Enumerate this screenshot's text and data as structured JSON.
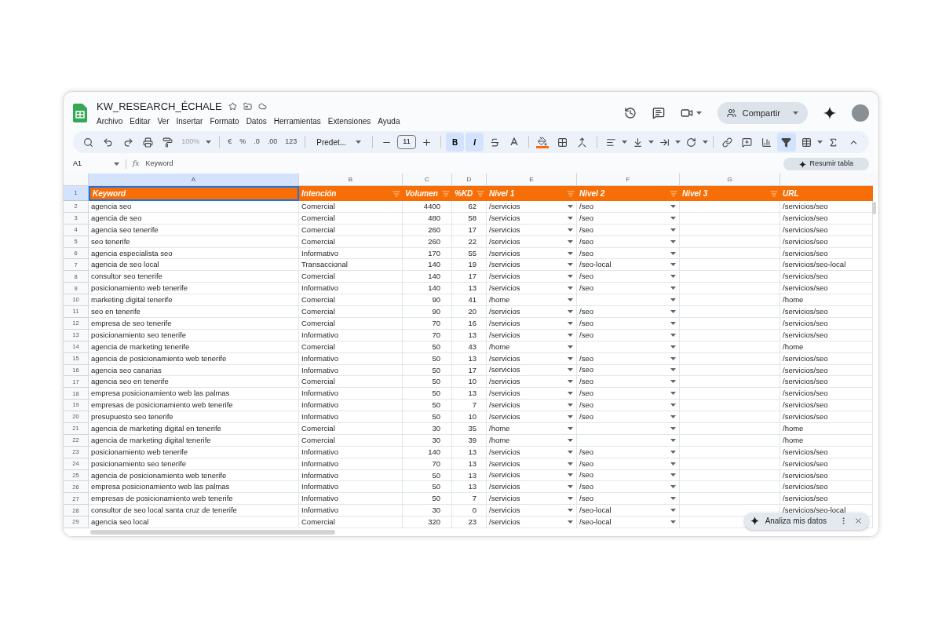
{
  "document": {
    "title": "KW_RESEARCH_ÉCHALE"
  },
  "menu": [
    "Archivo",
    "Editar",
    "Ver",
    "Insertar",
    "Formato",
    "Datos",
    "Herramientas",
    "Extensiones",
    "Ayuda"
  ],
  "share_button": "Compartir",
  "toolbar": {
    "zoom": "100%",
    "currency": "€",
    "percent": "%",
    "decrease_decimals": ".0",
    "increase_decimals": ".00",
    "number_format": "123",
    "font": "Predet...",
    "font_size": "11",
    "bold": {
      "label": "B",
      "selected": true
    },
    "italic": {
      "label": "I",
      "selected": true
    },
    "filter_selected": true
  },
  "formula_bar": {
    "cell_ref": "A1",
    "function_label": "fx",
    "value": "Keyword"
  },
  "summarize_button": "Resumir tabla",
  "columns": [
    {
      "letter": "A",
      "selected": true
    },
    {
      "letter": "B",
      "selected": false
    },
    {
      "letter": "C",
      "selected": false
    },
    {
      "letter": "D",
      "selected": false
    },
    {
      "letter": "E",
      "selected": false
    },
    {
      "letter": "F",
      "selected": false
    },
    {
      "letter": "G",
      "selected": false
    }
  ],
  "header_row": {
    "number": "1",
    "cells": [
      {
        "label": "Keyword",
        "filter": false,
        "selected": true
      },
      {
        "label": "Intención",
        "filter": true,
        "selected": false
      },
      {
        "label": "Volumen",
        "filter": true,
        "selected": false
      },
      {
        "label": "%KD",
        "filter": true,
        "selected": false
      },
      {
        "label": "Nivel 1",
        "filter": true,
        "selected": false
      },
      {
        "label": "Nivel 2",
        "filter": true,
        "selected": false
      },
      {
        "label": "Nivel 3",
        "filter": true,
        "selected": false
      },
      {
        "label": "URL",
        "filter": false,
        "selected": false
      }
    ]
  },
  "rows": [
    {
      "number": "2",
      "keyword": "agencia seo",
      "intent": "Comercial",
      "volume": "4400",
      "kd": "62",
      "level_1": "/servicios",
      "level_2": "/seo",
      "url": "/servicios/seo"
    },
    {
      "number": "3",
      "keyword": "agencia de seo",
      "intent": "Comercial",
      "volume": "480",
      "kd": "58",
      "level_1": "/servicios",
      "level_2": "/seo",
      "url": "/servicios/seo"
    },
    {
      "number": "4",
      "keyword": "agencia seo tenerife",
      "intent": "Comercial",
      "volume": "260",
      "kd": "17",
      "level_1": "/servicios",
      "level_2": "/seo",
      "url": "/servicios/seo"
    },
    {
      "number": "5",
      "keyword": "seo tenerife",
      "intent": "Comercial",
      "volume": "260",
      "kd": "22",
      "level_1": "/servicios",
      "level_2": "/seo",
      "url": "/servicios/seo"
    },
    {
      "number": "6",
      "keyword": "agencia especialista seo",
      "intent": "Informativo",
      "volume": "170",
      "kd": "55",
      "level_1": "/servicios",
      "level_2": "/seo",
      "url": "/servicios/seo"
    },
    {
      "number": "7",
      "keyword": "agencia de seo local",
      "intent": "Transaccional",
      "volume": "140",
      "kd": "19",
      "level_1": "/servicios",
      "level_2": "/seo-local",
      "url": "/servicios/seo-local"
    },
    {
      "number": "8",
      "keyword": "consultor seo tenerife",
      "intent": "Comercial",
      "volume": "140",
      "kd": "17",
      "level_1": "/servicios",
      "level_2": "/seo",
      "url": "/servicios/seo"
    },
    {
      "number": "9",
      "keyword": "posicionamiento web tenerife",
      "intent": "Informativo",
      "volume": "140",
      "kd": "13",
      "level_1": "/servicios",
      "level_2": "/seo",
      "url": "/servicios/seo"
    },
    {
      "number": "10",
      "keyword": "marketing digital tenerife",
      "intent": "Comercial",
      "volume": "90",
      "kd": "41",
      "level_1": "/home",
      "url": "/home"
    },
    {
      "number": "11",
      "keyword": "seo en tenerife",
      "intent": "Comercial",
      "volume": "90",
      "kd": "20",
      "level_1": "/servicios",
      "level_2": "/seo",
      "url": "/servicios/seo"
    },
    {
      "number": "12",
      "keyword": "empresa de seo tenerife",
      "intent": "Comercial",
      "volume": "70",
      "kd": "16",
      "level_1": "/servicios",
      "level_2": "/seo",
      "url": "/servicios/seo"
    },
    {
      "number": "13",
      "keyword": "posicionamiento seo tenerife",
      "intent": "Informativo",
      "volume": "70",
      "kd": "13",
      "level_1": "/servicios",
      "level_2": "/seo",
      "url": "/servicios/seo"
    },
    {
      "number": "14",
      "keyword": "agencia de marketing tenerife",
      "intent": "Comercial",
      "volume": "50",
      "kd": "43",
      "level_1": "/home",
      "url": "/home"
    },
    {
      "number": "15",
      "keyword": "agencia de posicionamiento web tenerife",
      "intent": "Informativo",
      "volume": "50",
      "kd": "13",
      "level_1": "/servicios",
      "level_2": "/seo",
      "url": "/servicios/seo"
    },
    {
      "number": "16",
      "keyword": "agencia seo canarias",
      "intent": "Informativo",
      "volume": "50",
      "kd": "17",
      "level_1": "/servicios",
      "level_2": "/seo",
      "url": "/servicios/seo"
    },
    {
      "number": "17",
      "keyword": "agencia seo en tenerife",
      "intent": "Comercial",
      "volume": "50",
      "kd": "10",
      "level_1": "/servicios",
      "level_2": "/seo",
      "url": "/servicios/seo"
    },
    {
      "number": "18",
      "keyword": "empresa posicionamiento web las palmas",
      "intent": "Informativo",
      "volume": "50",
      "kd": "13",
      "level_1": "/servicios",
      "level_2": "/seo",
      "url": "/servicios/seo"
    },
    {
      "number": "19",
      "keyword": "empresas de posicionamiento web tenerife",
      "intent": "Informativo",
      "volume": "50",
      "kd": "7",
      "level_1": "/servicios",
      "level_2": "/seo",
      "url": "/servicios/seo"
    },
    {
      "number": "20",
      "keyword": "presupuesto seo tenerife",
      "intent": "Informativo",
      "volume": "50",
      "kd": "10",
      "level_1": "/servicios",
      "level_2": "/seo",
      "url": "/servicios/seo"
    },
    {
      "number": "21",
      "keyword": "agencia de marketing digital en tenerife",
      "intent": "Comercial",
      "volume": "30",
      "kd": "35",
      "level_1": "/home",
      "url": "/home"
    },
    {
      "number": "22",
      "keyword": "agencia de marketing digital tenerife",
      "intent": "Comercial",
      "volume": "30",
      "kd": "39",
      "level_1": "/home",
      "url": "/home"
    },
    {
      "number": "23",
      "keyword": "posicionamiento web tenerife",
      "intent": "Informativo",
      "volume": "140",
      "kd": "13",
      "level_1": "/servicios",
      "level_2": "/seo",
      "url": "/servicios/seo"
    },
    {
      "number": "24",
      "keyword": "posicionamiento seo tenerife",
      "intent": "Informativo",
      "volume": "70",
      "kd": "13",
      "level_1": "/servicios",
      "level_2": "/seo",
      "url": "/servicios/seo"
    },
    {
      "number": "25",
      "keyword": "agencia de posicionamiento web tenerife",
      "intent": "Informativo",
      "volume": "50",
      "kd": "13",
      "level_1": "/servicios",
      "level_2": "/seo",
      "url": "/servicios/seo"
    },
    {
      "number": "26",
      "keyword": "empresa posicionamiento web las palmas",
      "intent": "Informativo",
      "volume": "50",
      "kd": "13",
      "level_1": "/servicios",
      "level_2": "/seo",
      "url": "/servicios/seo"
    },
    {
      "number": "27",
      "keyword": "empresas de posicionamiento web tenerife",
      "intent": "Informativo",
      "volume": "50",
      "kd": "7",
      "level_1": "/servicios",
      "level_2": "/seo",
      "url": "/servicios/seo"
    },
    {
      "number": "28",
      "keyword": "consultor de seo local santa cruz de tenerife",
      "intent": "Informativo",
      "volume": "30",
      "kd": "0",
      "level_1": "/servicios",
      "level_2": "/seo-local",
      "url": "/servicios/seo-local"
    },
    {
      "number": "29",
      "keyword": "agencia seo local",
      "intent": "Comercial",
      "volume": "320",
      "kd": "23",
      "level_1": "/servicios",
      "level_2": "/seo-local"
    }
  ],
  "assistant_chip": "Analiza mis datos"
}
